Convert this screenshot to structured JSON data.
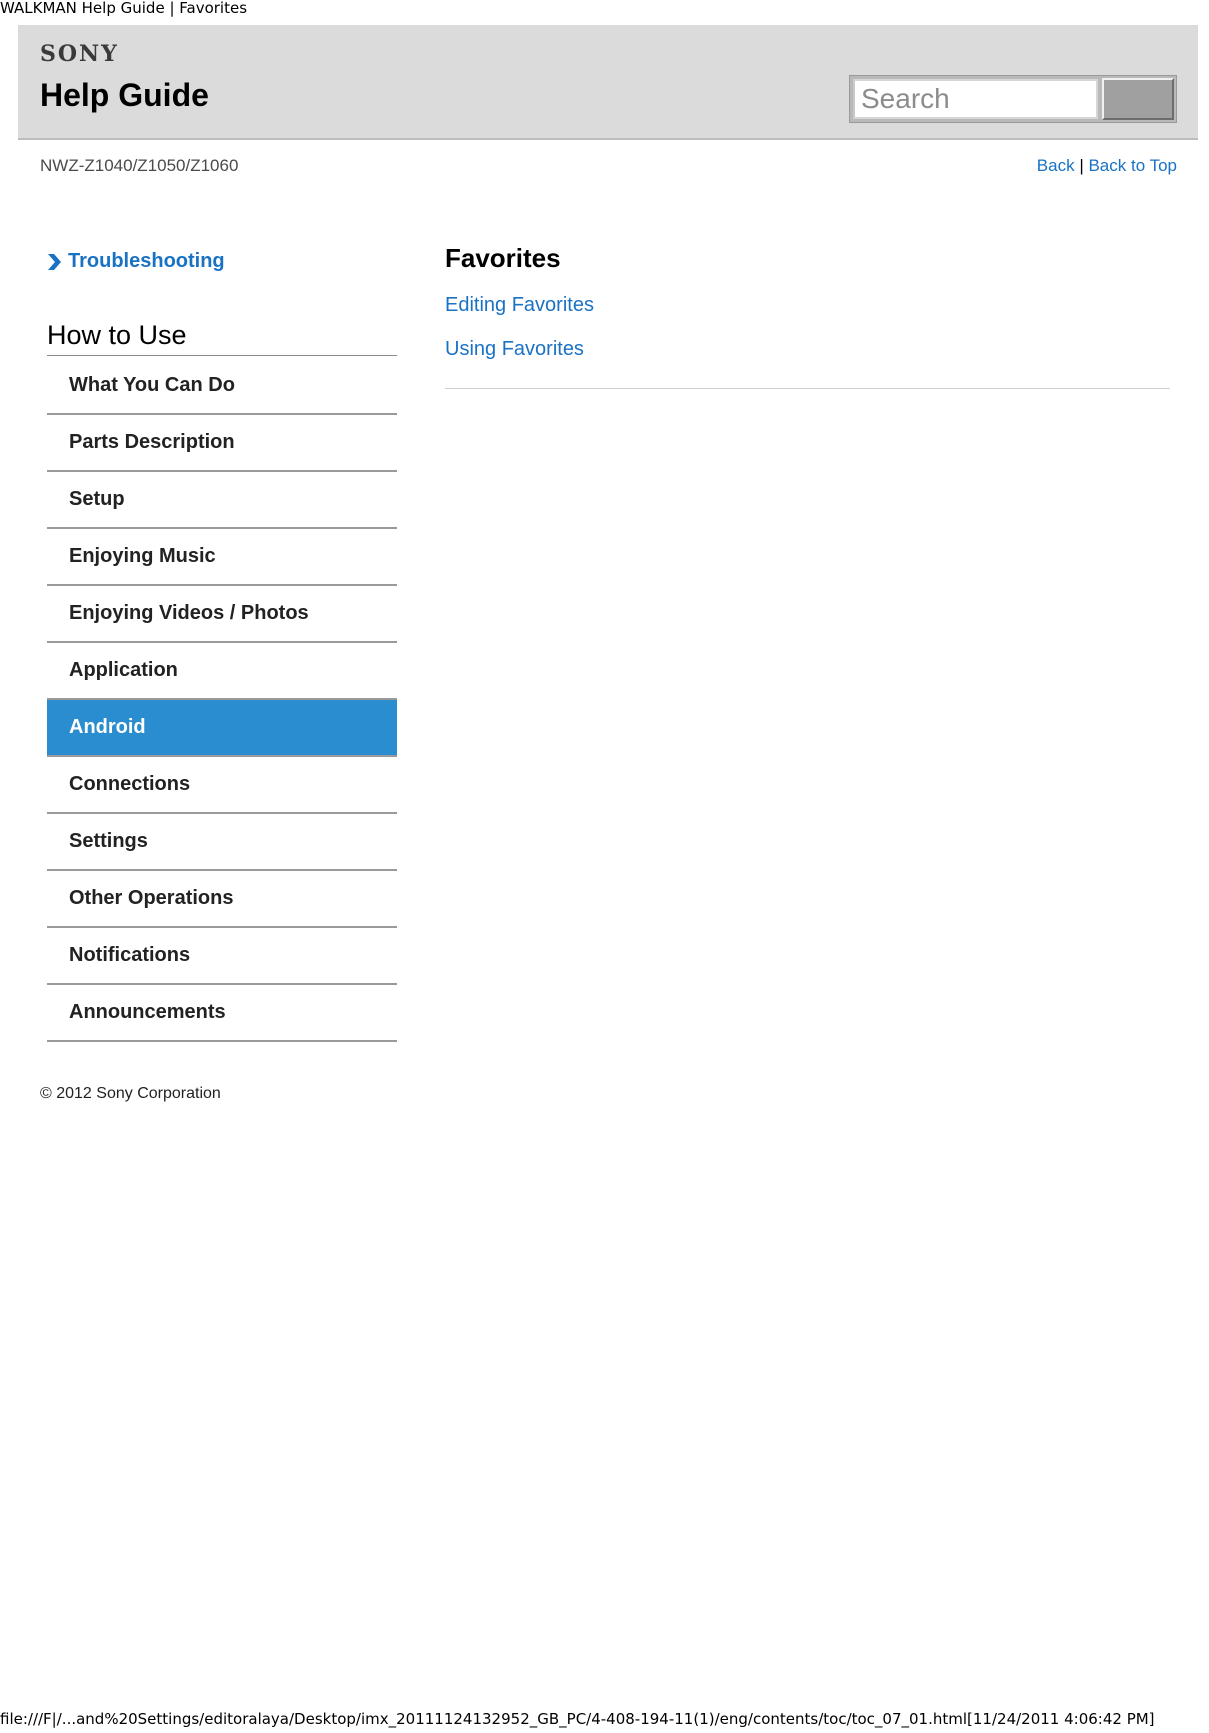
{
  "document_title": "WALKMAN Help Guide | Favorites",
  "header": {
    "brand": "SONY",
    "title": "Help Guide",
    "search": {
      "placeholder": "Search",
      "value": ""
    }
  },
  "subheader": {
    "model": "NWZ-Z1040/Z1050/Z1060",
    "back_label": "Back",
    "separator": "|",
    "back_to_top_label": "Back to Top"
  },
  "sidebar": {
    "troubleshooting_label": "Troubleshooting",
    "section_heading": "How to Use",
    "items": [
      {
        "label": "What You Can Do",
        "active": false
      },
      {
        "label": "Parts Description",
        "active": false
      },
      {
        "label": "Setup",
        "active": false
      },
      {
        "label": "Enjoying Music",
        "active": false
      },
      {
        "label": "Enjoying Videos / Photos",
        "active": false
      },
      {
        "label": "Application",
        "active": false
      },
      {
        "label": "Android",
        "active": true
      },
      {
        "label": "Connections",
        "active": false
      },
      {
        "label": "Settings",
        "active": false
      },
      {
        "label": "Other Operations",
        "active": false
      },
      {
        "label": "Notifications",
        "active": false
      },
      {
        "label": "Announcements",
        "active": false
      }
    ],
    "copyright": "© 2012 Sony Corporation"
  },
  "main": {
    "title": "Favorites",
    "links": [
      {
        "label": "Editing Favorites"
      },
      {
        "label": "Using Favorites"
      }
    ]
  },
  "footer": {
    "path": "file:///F|/...and%20Settings/editoralaya/Desktop/imx_20111124132952_GB_PC/4-408-194-11(1)/eng/contents/toc/toc_07_01.html[11/24/2011 4:06:42 PM]"
  },
  "colors": {
    "link": "#1a72c4",
    "active_bg": "#2a8dcf",
    "header_bg": "#dbdbdb"
  },
  "icons": {
    "troubleshooting": "chevron-right-icon"
  }
}
